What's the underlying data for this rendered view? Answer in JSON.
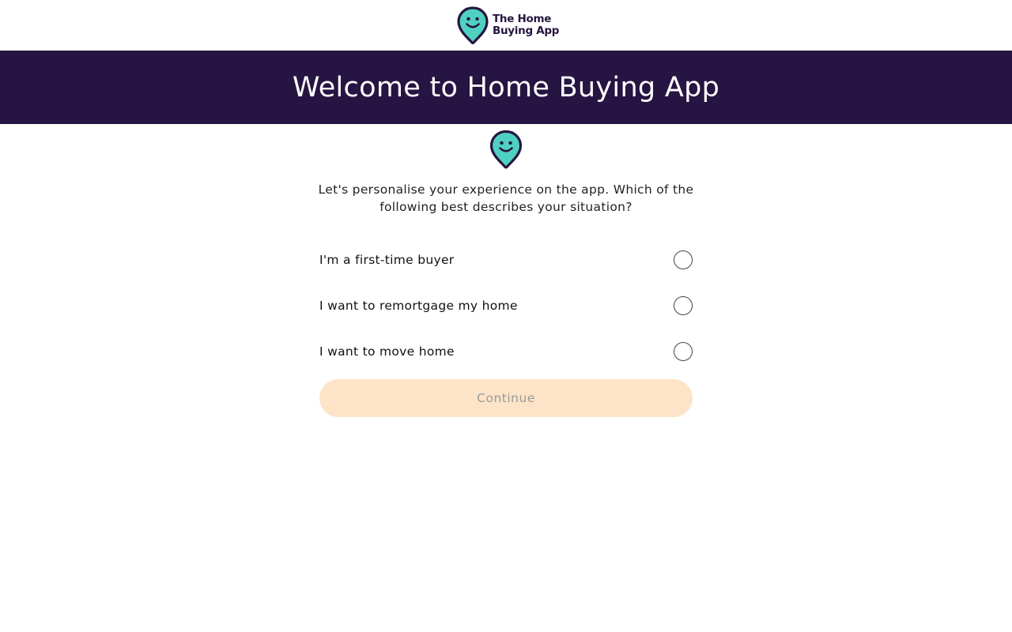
{
  "header": {
    "brand_line1": "The Home",
    "brand_line2": "Buying App",
    "logo_icon": "smiley-pin-icon"
  },
  "banner": {
    "title": "Welcome to Home Buying App"
  },
  "intro": {
    "icon": "smiley-pin-icon",
    "text": "Let's personalise your experience on the app. Which of the following best describes your situation?"
  },
  "options": [
    {
      "label": "I'm a first-time buyer",
      "selected": false
    },
    {
      "label": "I want to remortgage my home",
      "selected": false
    },
    {
      "label": "I want to move home",
      "selected": false
    }
  ],
  "continue_button": {
    "label": "Continue",
    "disabled": true
  },
  "colors": {
    "banner_bg": "#261542",
    "pin_fill": "#4fd1c1",
    "pin_outline": "#26163f",
    "button_bg": "#fde3c8",
    "button_text": "#9a9a9a"
  }
}
